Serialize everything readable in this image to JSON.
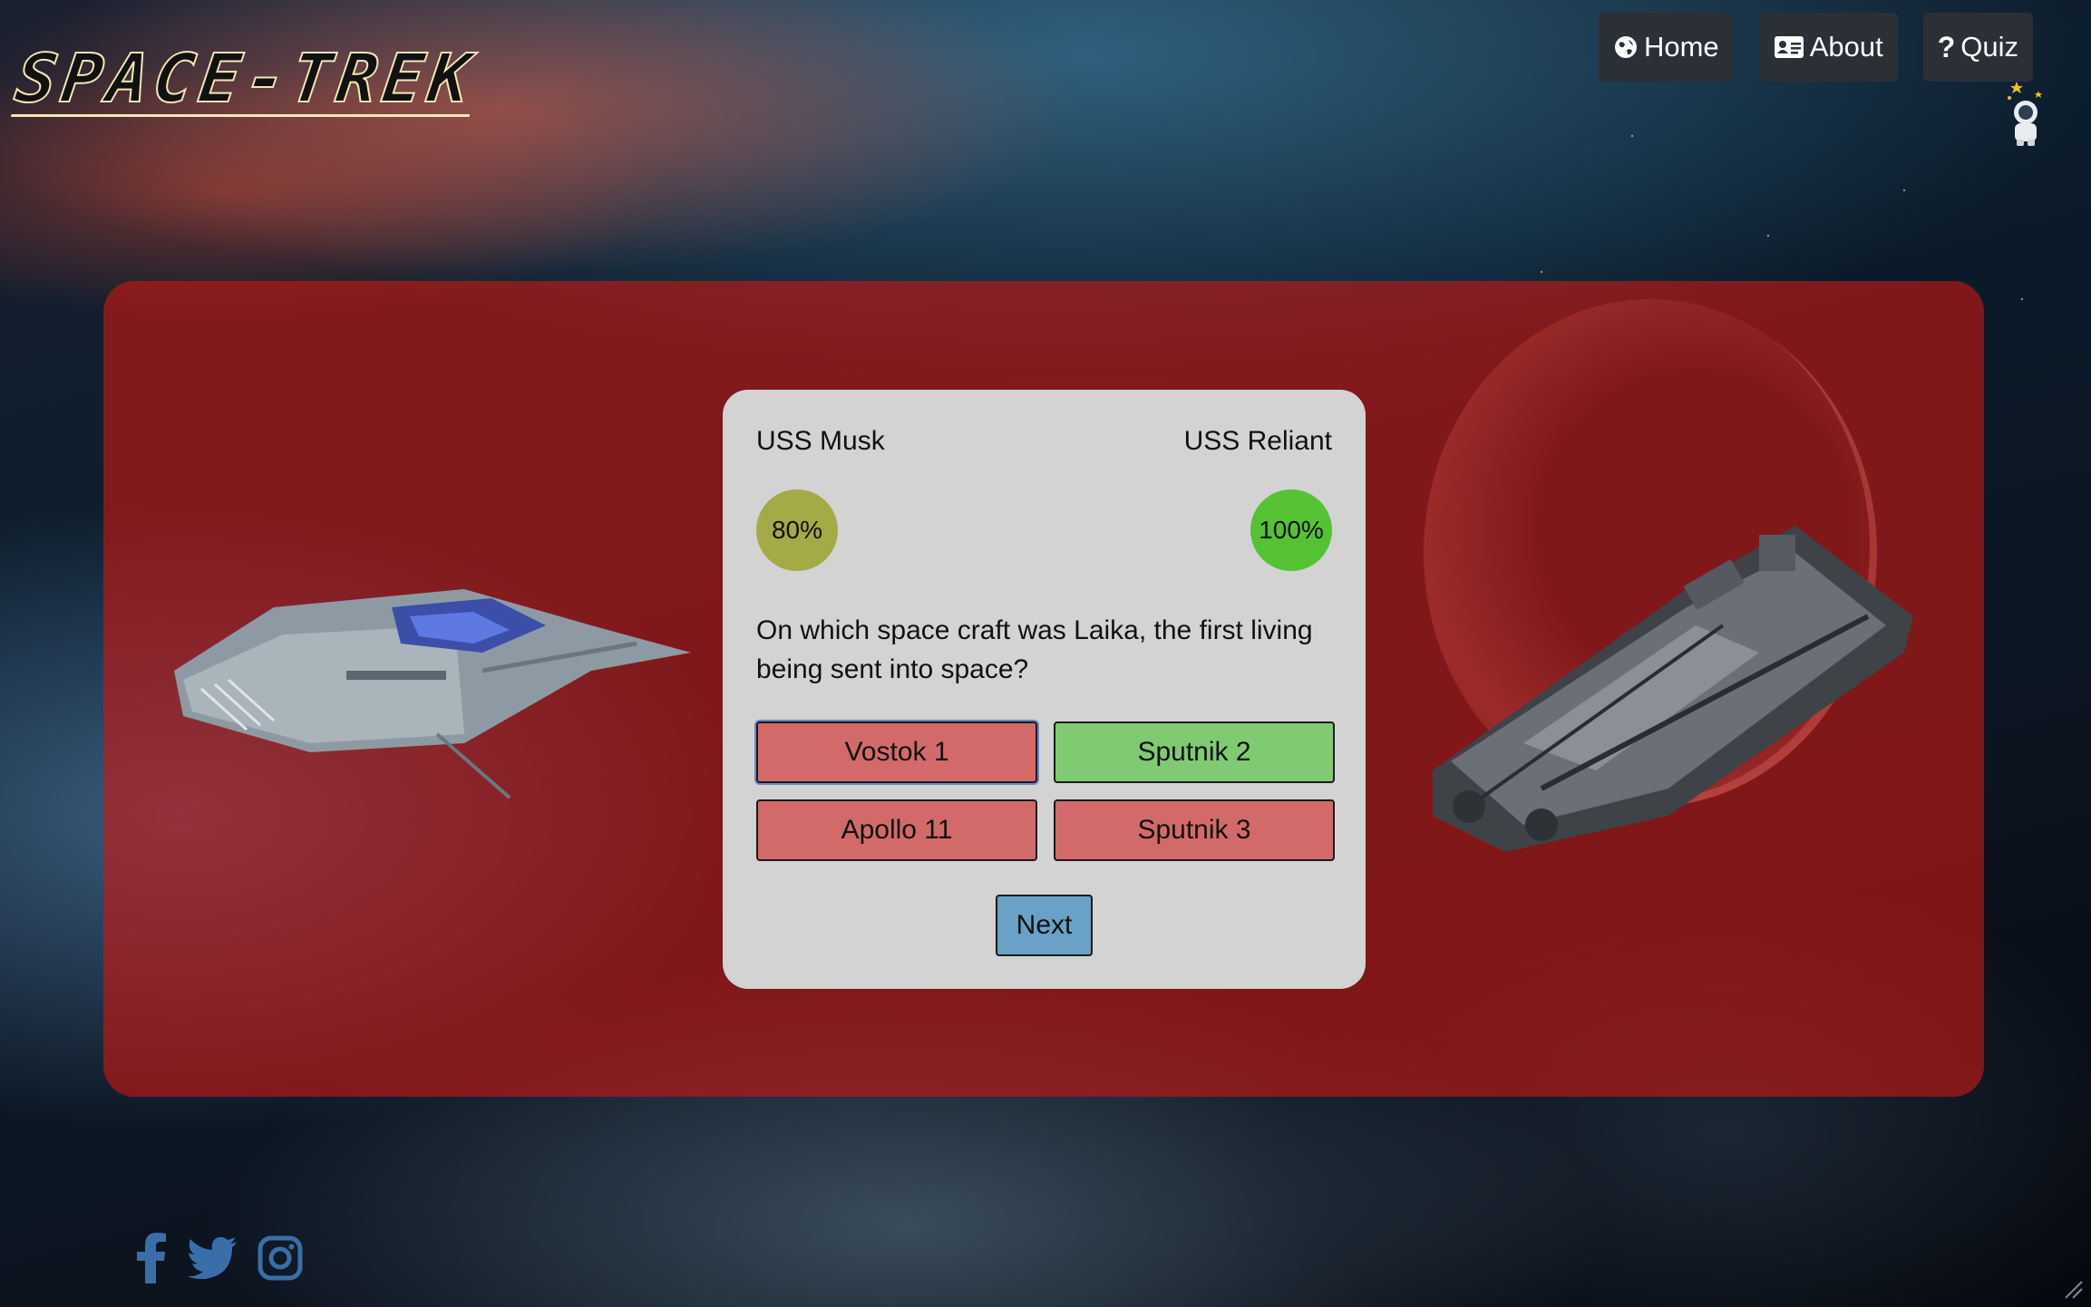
{
  "brand": {
    "logo_text": "SPACE-TREK"
  },
  "nav": {
    "items": [
      {
        "label": "Home",
        "icon": "globe-icon"
      },
      {
        "label": "About",
        "icon": "id-card-icon"
      },
      {
        "label": "Quiz",
        "icon": "question-icon"
      }
    ]
  },
  "game": {
    "player_left": {
      "name": "USS Musk",
      "score": "80%",
      "color": "#a4aa45"
    },
    "player_right": {
      "name": "USS Reliant",
      "score": "100%",
      "color": "#55c234"
    },
    "question": "On which space craft was Laika, the first living being sent into space?",
    "answers": [
      {
        "label": "Vostok 1",
        "state": "wrong-selected"
      },
      {
        "label": "Sputnik 2",
        "state": "correct"
      },
      {
        "label": "Apollo 11",
        "state": "wrong"
      },
      {
        "label": "Sputnik 3",
        "state": "wrong"
      }
    ],
    "next_label": "Next"
  },
  "colors": {
    "panel": "#c8191480",
    "card": "#d3d3d3",
    "wrong": "#d36a6a",
    "correct": "#80cb72",
    "next": "#6aa1c6",
    "nav_bg": "#2b2f36"
  },
  "footer": {
    "social": [
      "facebook-icon",
      "twitter-icon",
      "instagram-icon"
    ]
  }
}
